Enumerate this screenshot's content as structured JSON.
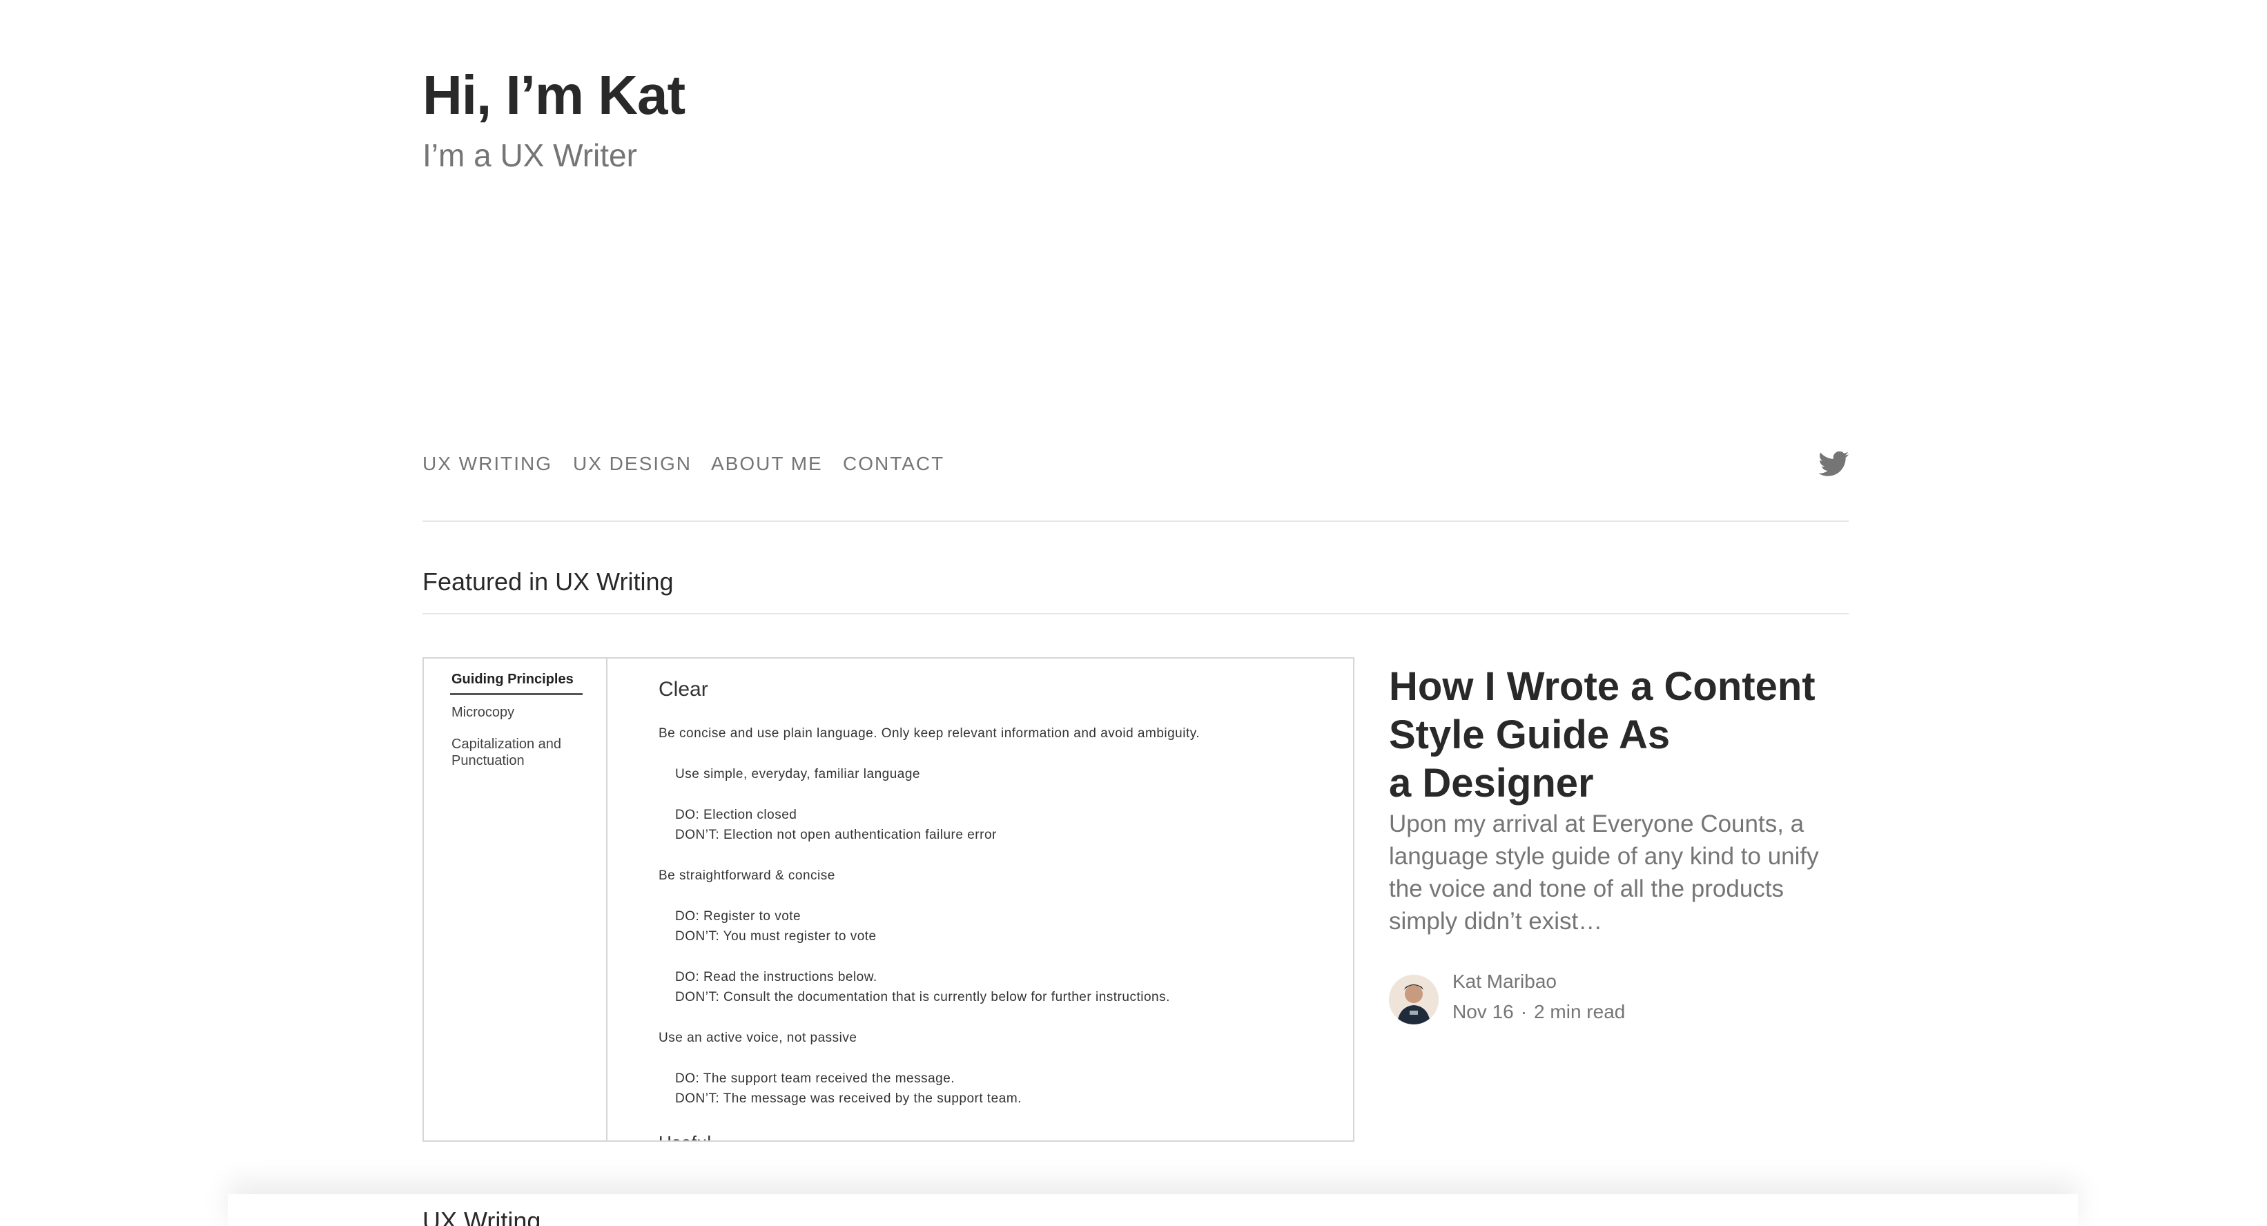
{
  "header": {
    "title": "Hi, I’m Kat",
    "subtitle": "I’m a UX Writer"
  },
  "nav": {
    "items": [
      {
        "label": "UX WRITING"
      },
      {
        "label": "UX DESIGN"
      },
      {
        "label": "ABOUT ME"
      },
      {
        "label": "CONTACT"
      }
    ],
    "social_icon": "twitter-icon"
  },
  "featured": {
    "heading": "Featured in UX Writing",
    "image": {
      "sidebar": [
        "Guiding Principles",
        "Microcopy",
        "Capitalization and Punctuation"
      ],
      "heading": "Clear",
      "lines": [
        "Be concise and use plain language. Only keep relevant information and avoid ambiguity.",
        "Use simple, everyday, familiar language",
        "DO: Election closed",
        "DON’T:  Election not open authentication failure error",
        "Be straightforward & concise",
        "DO: Register to vote",
        "DON’T: You must register to vote",
        "DO: Read the instructions below.",
        "DON’T: Consult the documentation that is currently below for further instructions.",
        "Use an active voice, not passive",
        "DO:  The support team received the message.",
        "DON’T: The message was received by the support team.",
        "Useful"
      ]
    },
    "article": {
      "title_lines": [
        "How I Wrote a Content",
        "Style Guide As",
        "a Designer"
      ],
      "excerpt_lines": [
        "Upon my arrival at Everyone Counts, a",
        "language style guide of any kind to unify",
        "the voice and tone of all the products",
        "simply didn’t exist…"
      ],
      "author": "Kat Maribao",
      "date": "Nov 16",
      "separator": "·",
      "read_time": "2 min read"
    }
  },
  "next_section": {
    "heading": "UX Writing"
  },
  "colors": {
    "text": "#292929",
    "muted": "#757575",
    "divider": "#e6e6e6"
  }
}
